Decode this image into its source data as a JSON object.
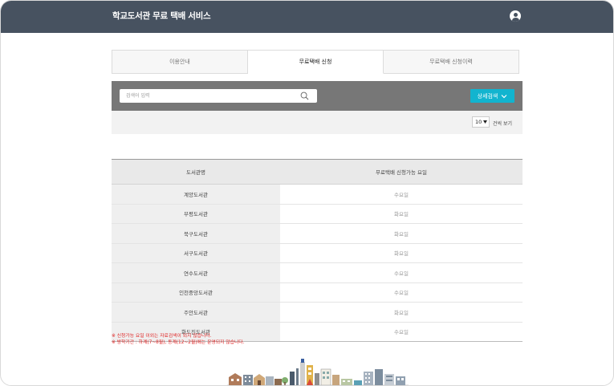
{
  "header": {
    "title": "학교도서관 무료 택배 서비스",
    "user_icon": "user-icon"
  },
  "tabs": [
    {
      "label": "이용안내",
      "active": false
    },
    {
      "label": "무료택배 신청",
      "active": true
    },
    {
      "label": "무료택배 신청이력",
      "active": false
    }
  ],
  "search": {
    "placeholder": "검색어 입력",
    "advanced_label": "상세검색",
    "icon": "search-icon"
  },
  "page_size": {
    "value": "10",
    "label": "건씩 보기"
  },
  "table": {
    "headers": [
      "도서관명",
      "무료택배 신청가능 요일"
    ],
    "rows": [
      {
        "library": "계양도서관",
        "day": "수요일"
      },
      {
        "library": "부평도서관",
        "day": "화요일"
      },
      {
        "library": "북구도서관",
        "day": "화요일"
      },
      {
        "library": "서구도서관",
        "day": "화요일"
      },
      {
        "library": "연수도서관",
        "day": "수요일"
      },
      {
        "library": "인천중앙도서관",
        "day": "수요일"
      },
      {
        "library": "주안도서관",
        "day": "화요일"
      },
      {
        "library": "화도진도서관",
        "day": "수요일"
      }
    ]
  },
  "notes": [
    "※ 신청가능 요일 이외는 자료검색이 되지 않습니다.",
    "※ 방학기간 : 하계(7~8월), 동계(12~2월)에는 운영되지 않습니다."
  ],
  "colors": {
    "header_bg": "#475260",
    "accent": "#12b4cf",
    "note": "#e02020"
  }
}
